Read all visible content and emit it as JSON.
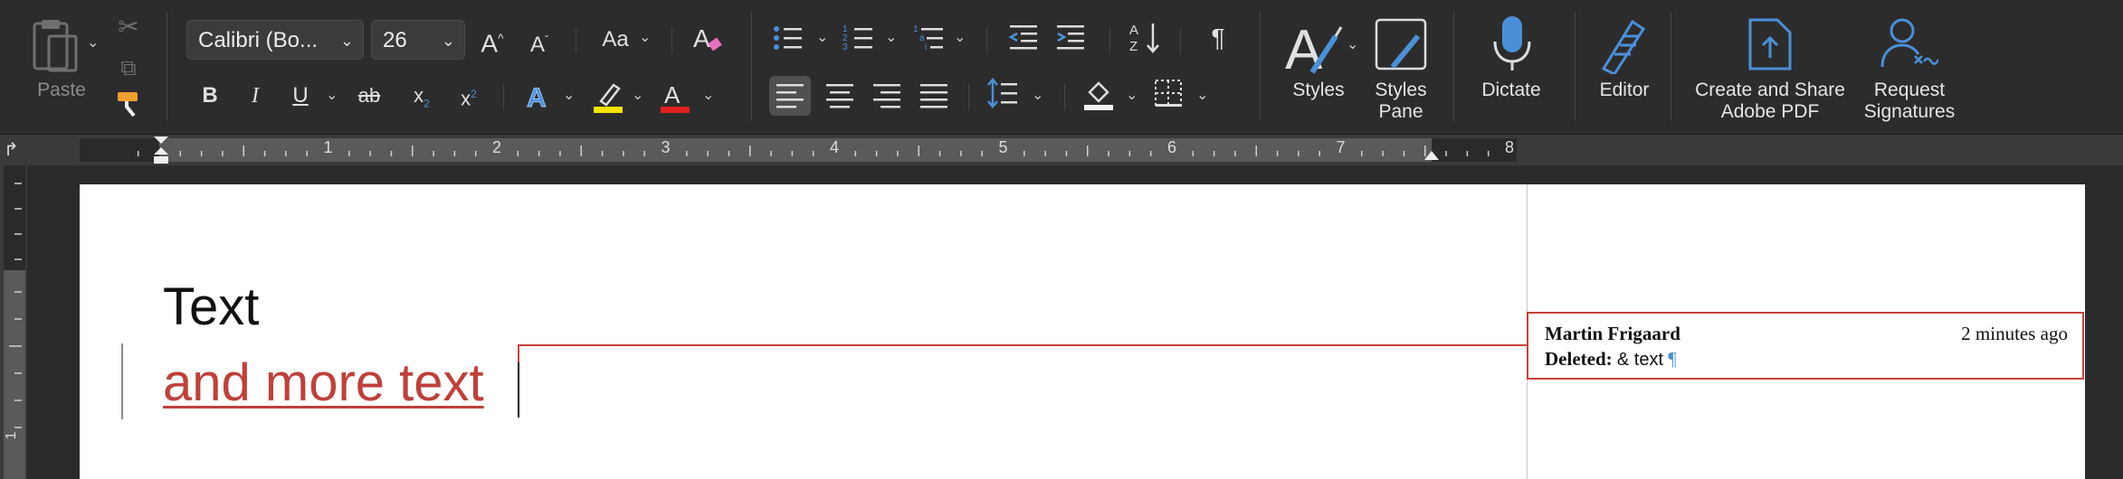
{
  "ribbon": {
    "paste_label": "Paste",
    "font_name": "Calibri (Bo...",
    "font_size": "26",
    "grow_font": "A",
    "shrink_font": "A",
    "change_case": "Aa",
    "bold": "B",
    "italic": "I",
    "underline": "U",
    "strikethrough": "ab",
    "subscript": "x",
    "superscript": "x",
    "pilcrow": "¶",
    "styles_label": "Styles",
    "styles_pane_label": "Styles\nPane",
    "dictate_label": "Dictate",
    "editor_label": "Editor",
    "create_pdf_label": "Create and Share\nAdobe PDF",
    "request_signatures_label": "Request\nSignatures"
  },
  "ruler": {
    "numbers": [
      "1",
      "2",
      "3",
      "4",
      "5",
      "6",
      "7",
      "8"
    ]
  },
  "vertical_ruler": {
    "number": "1"
  },
  "document": {
    "line1": "Text",
    "line2": "and more text"
  },
  "comment": {
    "author": "Martin Frigaard",
    "time": "2 minutes ago",
    "action": "Deleted:",
    "deleted_text": "& text",
    "pilcrow": "¶"
  },
  "colors": {
    "inserted_text": "#c0403a",
    "accent_blue": "#4a90d9",
    "highlight_yellow": "#f5e500",
    "font_color_red": "#e02020"
  }
}
